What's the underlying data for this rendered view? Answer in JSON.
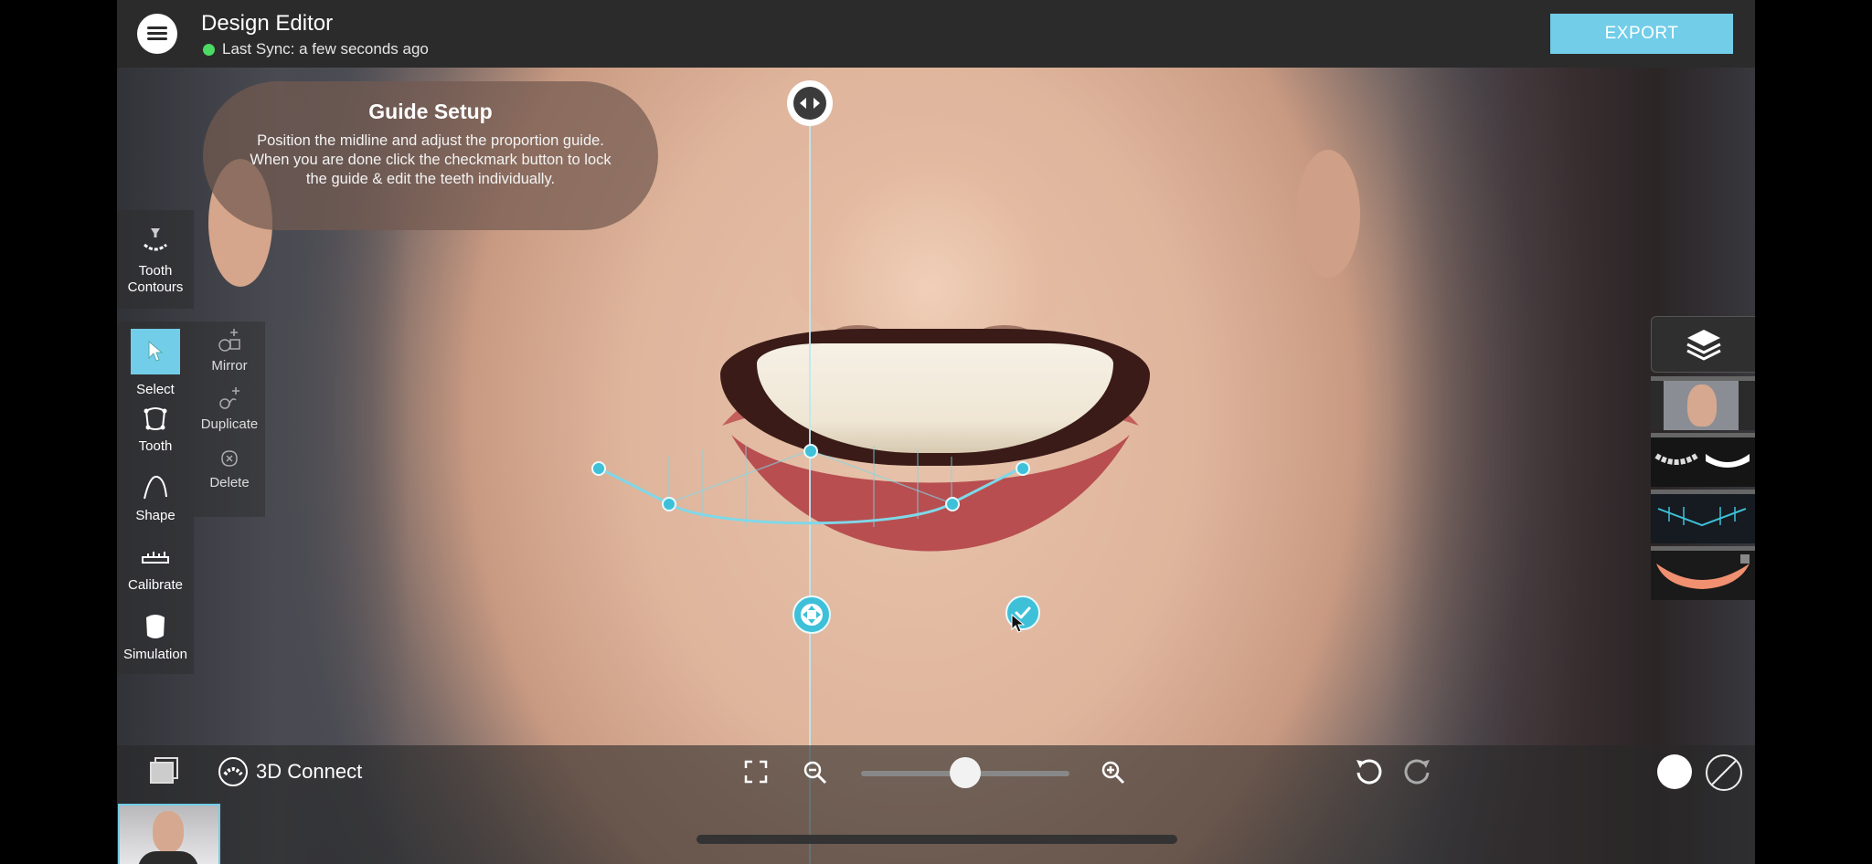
{
  "header": {
    "title": "Design Editor",
    "sync_status": "Last Sync: a few seconds ago",
    "export_label": "EXPORT"
  },
  "guide": {
    "title": "Guide Setup",
    "text": "Position the midline and adjust the proportion guide.  When you are done click the checkmark button to lock the guide & edit the teeth individually."
  },
  "tools": {
    "tooth_contours": "Tooth Contours",
    "select": "Select",
    "tooth": "Tooth",
    "shape": "Shape",
    "calibrate": "Calibrate",
    "simulation": "Simulation"
  },
  "sub_tools": {
    "mirror": "Mirror",
    "duplicate": "Duplicate",
    "delete": "Delete"
  },
  "bottom": {
    "connect_label": "3D Connect",
    "zoom_level": 0.5
  },
  "colors": {
    "accent": "#72cde8",
    "guide_line": "#3ec0d8",
    "sync_ok": "#4cd964"
  },
  "icons": {
    "menu": "menu-icon",
    "layers": "layers-icon",
    "undo": "undo-icon",
    "redo": "redo-icon",
    "fullscreen": "fullscreen-icon",
    "zoom_out": "zoom-out-icon",
    "zoom_in": "zoom-in-icon",
    "checkmark": "checkmark-icon"
  }
}
